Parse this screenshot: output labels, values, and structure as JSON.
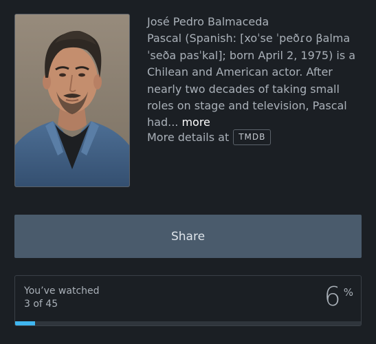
{
  "person": {
    "name": "José Pedro Balmaceda",
    "bio_text": "Pascal (Spanish: [xoˈse ˈpeðɾo βalmaˈseða pasˈkal]; born April 2, 1975) is a Chilean and American actor. After nearly two decades of taking small roles on stage and television, Pascal had...",
    "more_label": "more"
  },
  "details": {
    "prefix": "More details at",
    "source_badge": "TMDB"
  },
  "share": {
    "label": "Share"
  },
  "watched": {
    "label": "You’ve watched",
    "count_text": "3 of 45",
    "watched_count": 3,
    "total_count": 45,
    "percent_value": "6",
    "percent_symbol": "%",
    "progress_fraction": 0.058
  },
  "colors": {
    "background": "#1b1f24",
    "share_button": "#4a5b6c",
    "progress_fill": "#40b6f0"
  }
}
